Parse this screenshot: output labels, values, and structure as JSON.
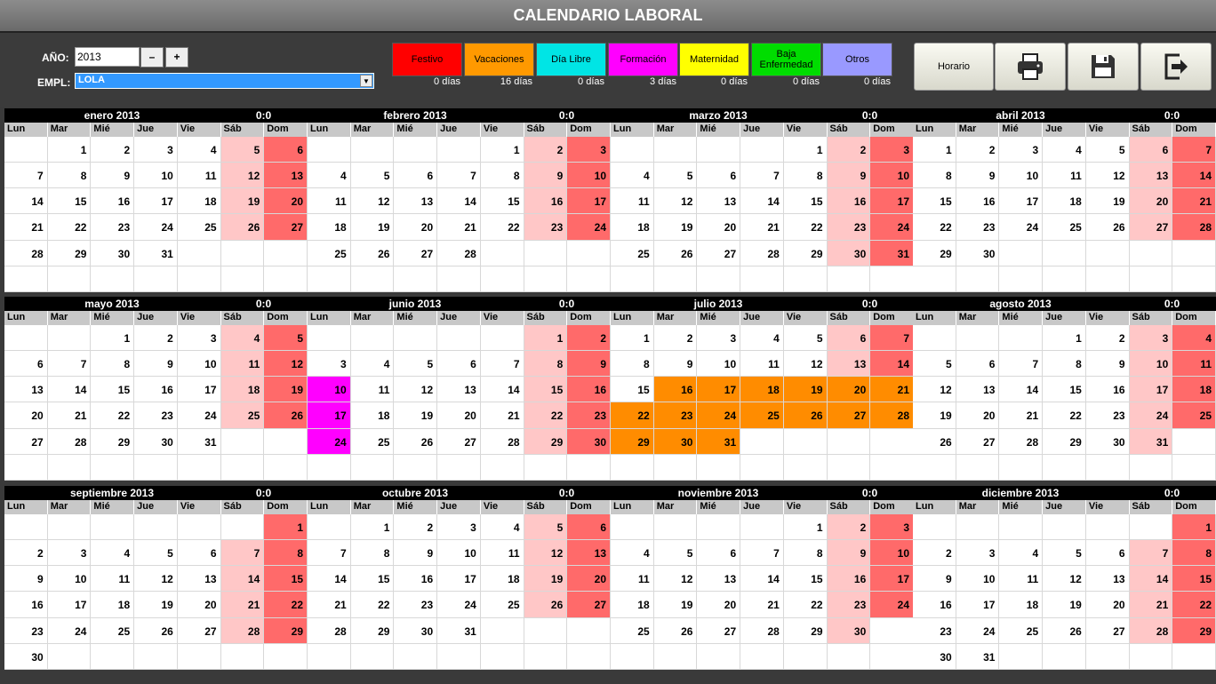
{
  "title": "CALENDARIO LABORAL",
  "form": {
    "year_label": "AÑO:",
    "year_value": "2013",
    "minus": "–",
    "plus": "+",
    "empl_label": "EMPL:",
    "empl_value": "LOLA"
  },
  "legend": [
    {
      "label": "Festivo",
      "count": "0 días",
      "color": "#ff0000"
    },
    {
      "label": "Vacaciones",
      "count": "16 días",
      "color": "#ff9900"
    },
    {
      "label": "Día Libre",
      "count": "0 días",
      "color": "#00e5e5"
    },
    {
      "label": "Formación",
      "count": "3 días",
      "color": "#ff00ff"
    },
    {
      "label": "Maternidad",
      "count": "0 días",
      "color": "#ffff00"
    },
    {
      "label": "Baja Enfermedad",
      "count": "0 días",
      "color": "#00dd00"
    },
    {
      "label": "Otros",
      "count": "0 días",
      "color": "#9999ff"
    }
  ],
  "buttons": {
    "horario": "Horario",
    "print_icon": "printer-icon",
    "save_icon": "floppy-disk-icon",
    "exit_icon": "exit-icon"
  },
  "days_of_week": [
    "Lun",
    "Mar",
    "Mié",
    "Jue",
    "Vie",
    "Sáb",
    "Dom"
  ],
  "months": [
    {
      "name": "enero 2013",
      "hours": "0:0",
      "first_weekday": 1,
      "days": 31,
      "vacaciones": [],
      "formacion": []
    },
    {
      "name": "febrero 2013",
      "hours": "0:0",
      "first_weekday": 4,
      "days": 28,
      "vacaciones": [],
      "formacion": []
    },
    {
      "name": "marzo 2013",
      "hours": "0:0",
      "first_weekday": 4,
      "days": 31,
      "vacaciones": [],
      "formacion": []
    },
    {
      "name": "abril 2013",
      "hours": "0:0",
      "first_weekday": 0,
      "days": 30,
      "vacaciones": [],
      "formacion": []
    },
    {
      "name": "mayo 2013",
      "hours": "0:0",
      "first_weekday": 2,
      "days": 31,
      "vacaciones": [],
      "formacion": []
    },
    {
      "name": "junio 2013",
      "hours": "0:0",
      "first_weekday": 5,
      "days": 30,
      "vacaciones": [],
      "formacion": [
        10,
        17,
        24
      ]
    },
    {
      "name": "julio 2013",
      "hours": "0:0",
      "first_weekday": 0,
      "days": 31,
      "vacaciones": [
        16,
        17,
        18,
        19,
        20,
        21,
        22,
        23,
        24,
        25,
        26,
        27,
        28,
        29,
        30,
        31
      ],
      "formacion": []
    },
    {
      "name": "agosto 2013",
      "hours": "0:0",
      "first_weekday": 3,
      "days": 31,
      "vacaciones": [],
      "formacion": []
    },
    {
      "name": "septiembre 2013",
      "hours": "0:0",
      "first_weekday": 6,
      "days": 30,
      "vacaciones": [],
      "formacion": []
    },
    {
      "name": "octubre 2013",
      "hours": "0:0",
      "first_weekday": 1,
      "days": 31,
      "vacaciones": [],
      "formacion": []
    },
    {
      "name": "noviembre 2013",
      "hours": "0:0",
      "first_weekday": 4,
      "days": 30,
      "vacaciones": [],
      "formacion": []
    },
    {
      "name": "diciembre 2013",
      "hours": "0:0",
      "first_weekday": 6,
      "days": 31,
      "vacaciones": [],
      "formacion": []
    }
  ]
}
